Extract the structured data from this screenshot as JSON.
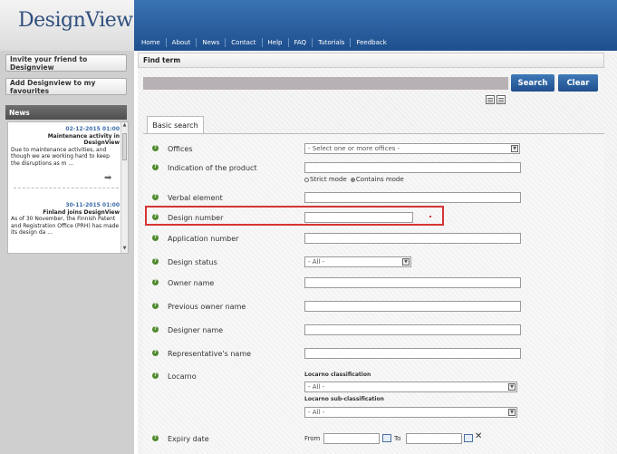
{
  "logo": "DesignView",
  "nav": [
    "Home",
    "About",
    "News",
    "Contact",
    "Help",
    "FAQ",
    "Tutorials",
    "Feedback"
  ],
  "sidebar": {
    "invite_label": "Invite your friend to Designview",
    "favourites_label": "Add Designview to my favourites",
    "news_heading": "News",
    "news": [
      {
        "date": "02-12-2015 01:00",
        "title": "Maintenance activity in DesignView",
        "body": "Due to maintenance activities, and though we are working hard to keep the disruptions as m ..."
      },
      {
        "date": "30-11-2015 01:00",
        "title": "Finland joins DesignView",
        "body": "As of 30 November, the Finnish Patent and Registration Office (PRH) has made its design da ..."
      }
    ]
  },
  "main": {
    "findterm_label": "Find term",
    "search_label": "Search",
    "clear_label": "Clear",
    "tab_label": "Basic search",
    "fields": {
      "offices": {
        "label": "Offices",
        "value": "- Select one or more offices -"
      },
      "indication": {
        "label": "Indication of the product",
        "strict": "Strict mode",
        "contains": "Contains mode"
      },
      "verbal": {
        "label": "Verbal element"
      },
      "design_number": {
        "label": "Design number"
      },
      "application_number": {
        "label": "Application number"
      },
      "design_status": {
        "label": "Design status",
        "value": "- All -"
      },
      "owner": {
        "label": "Owner name"
      },
      "previous_owner": {
        "label": "Previous owner name"
      },
      "designer": {
        "label": "Designer name"
      },
      "representative": {
        "label": "Representative's name"
      },
      "locarno": {
        "label": "Locarno",
        "classification": "Locarno classification",
        "classification_value": "- All -",
        "sub": "Locarno sub-classification",
        "sub_value": "- All -"
      },
      "expiry": {
        "label": "Expiry date",
        "from": "From",
        "to": "To"
      }
    }
  }
}
